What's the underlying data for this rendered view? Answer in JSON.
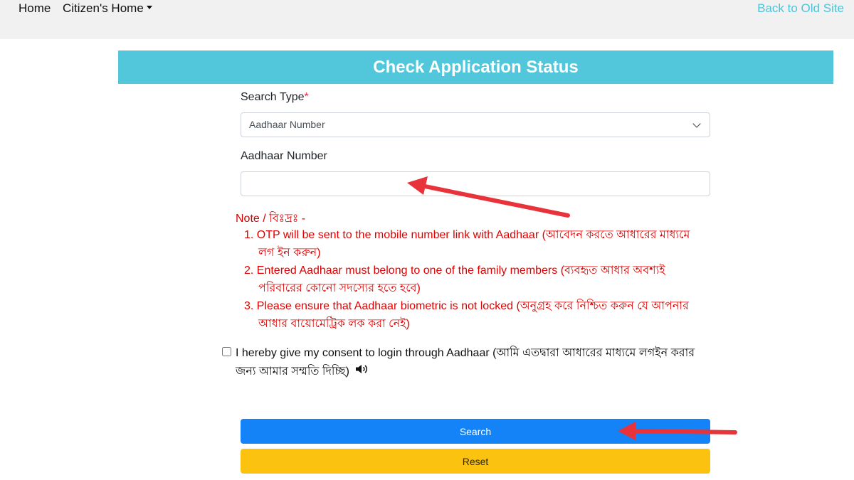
{
  "nav": {
    "home": "Home",
    "citizens_home": "Citizen's Home",
    "back_to_old_site": "Back to Old Site"
  },
  "banner": {
    "title": "Check Application Status"
  },
  "form": {
    "search_type_label": "Search Type",
    "required_mark": "*",
    "search_type_selected": "Aadhaar Number",
    "aadhaar_label": "Aadhaar Number",
    "aadhaar_value": ""
  },
  "note": {
    "title": "Note / বিঃদ্রঃ -",
    "items": [
      "1. OTP will be sent to the mobile number link with Aadhaar (আবেদন করতে আধারের মাধ্যমে লগ ইন করুন)",
      "2. Entered Aadhaar must belong to one of the family members (ব্যবহৃত আধার অবশ্যই পরিবারের কোনো সদস্যের হতে হবে)",
      "3. Please ensure that Aadhaar biometric is not locked (অনুগ্রহ করে নিশ্চিত করুন যে আপনার আধার বায়োমেট্রিক লক করা নেই)"
    ]
  },
  "consent": {
    "text": "I hereby give my consent to login through Aadhaar (আমি এতদ্বারা আধারের মাধ্যমে লগইন করার জন্য আমার সম্মতি দিচ্ছি)"
  },
  "buttons": {
    "search": "Search",
    "reset": "Reset"
  },
  "icons": {
    "speaker": "speaker-icon",
    "chevron": "chevron-down-icon",
    "annotation_arrow": "red-arrow"
  },
  "colors": {
    "banner": "#52c6da",
    "search": "#1483f8",
    "reset": "#fbc30f",
    "note": "#e00000",
    "arrow": "#e8333a"
  }
}
